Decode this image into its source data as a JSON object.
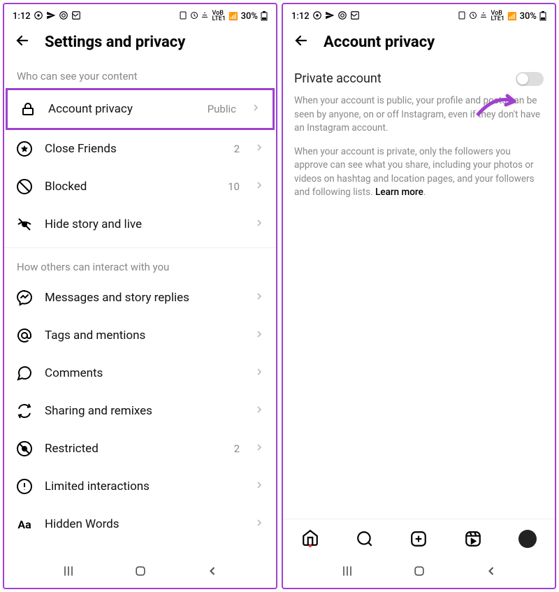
{
  "status": {
    "time": "1:12",
    "battery": "30%",
    "lte": "LTE1",
    "volte": "VoB"
  },
  "left": {
    "title": "Settings and privacy",
    "section1": "Who can see your content",
    "section2": "How others can interact with you",
    "rows1": [
      {
        "label": "Account privacy",
        "value": "Public"
      },
      {
        "label": "Close Friends",
        "value": "2"
      },
      {
        "label": "Blocked",
        "value": "10"
      },
      {
        "label": "Hide story and live",
        "value": ""
      }
    ],
    "rows2": [
      {
        "label": "Messages and story replies"
      },
      {
        "label": "Tags and mentions"
      },
      {
        "label": "Comments"
      },
      {
        "label": "Sharing and remixes"
      },
      {
        "label": "Restricted",
        "value": "2"
      },
      {
        "label": "Limited interactions"
      },
      {
        "label": "Hidden Words"
      }
    ]
  },
  "right": {
    "title": "Account privacy",
    "toggle_label": "Private account",
    "desc1": "When your account is public, your profile and posts can be seen by anyone, on or off Instagram, even if they don't have an Instagram account.",
    "desc2": "When your account is private, only the followers you approve can see what you share, including your photos or videos on hashtag and location pages, and your followers and following lists. ",
    "learn": "Learn more"
  }
}
